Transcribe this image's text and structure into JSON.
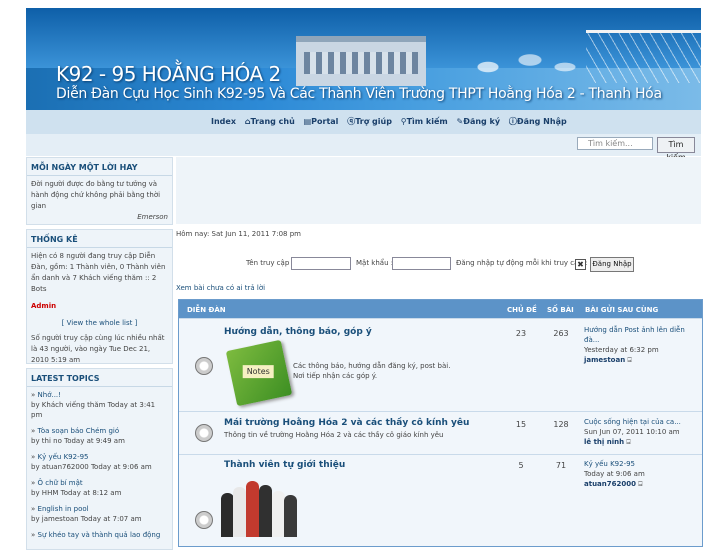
{
  "banner": {
    "title": "K92 - 95 HOẰNG HÓA 2",
    "subtitle": "Diễn Đàn Cựu Học Sinh K92-95 Và Các Thành Viên Trường THPT Hoằng Hóa 2 - Thanh Hóa"
  },
  "nav": {
    "items": [
      {
        "label": "Index",
        "icon": ""
      },
      {
        "label": "Trang chủ",
        "icon": "home-icon"
      },
      {
        "label": "Portal",
        "icon": "portal-icon"
      },
      {
        "label": "Trợ giúp",
        "icon": "help-icon"
      },
      {
        "label": "Tìm kiếm",
        "icon": "search-icon"
      },
      {
        "label": "Đăng ký",
        "icon": "register-icon"
      },
      {
        "label": "Đăng Nhập",
        "icon": "login-icon"
      }
    ]
  },
  "search": {
    "placeholder": "Tìm kiếm...",
    "button": "Tìm kiếm"
  },
  "quote": {
    "header": "MỖI NGÀY MỘT LỜI HAY",
    "text": "Đời người được đo bằng tư tưởng và hành động chứ không phải bằng thời gian",
    "author": "Emerson"
  },
  "stats": {
    "header": "THỐNG KÊ",
    "online": "Hiện có 8 người đang truy cập Diễn Đàn, gồm: 1 Thành viên, 0 Thành viên ẩn danh và 7 Khách viếng thăm :: 2 Bots",
    "admin": "Admin",
    "view_list": "[ View the whole list ]",
    "record": "Số người truy cập cùng lúc nhiều nhất là 43 người, vào ngày Tue Dec 21, 2010 5:19 am"
  },
  "latest": {
    "header": "LATEST TOPICS",
    "items": [
      {
        "title": "Nhớ...!",
        "meta": "by Khách viếng thăm Today at 3:41 pm"
      },
      {
        "title": "Tòa soạn báo Chém gió",
        "meta": "by thi no Today at 9:49 am"
      },
      {
        "title": "Kỷ yếu K92-95",
        "meta": "by atuan762000 Today at 9:06 am"
      },
      {
        "title": "Ô chữ bí mật",
        "meta": "by HHM Today at 8:12 am"
      },
      {
        "title": "English in pool",
        "meta": "by jamestoan Today at 7:07 am"
      },
      {
        "title": "Sự khéo tay và thành quả lao động",
        "meta": ""
      }
    ]
  },
  "main": {
    "now": "Hôm nay: Sat Jun 11, 2011 7:08 pm",
    "username_label": "Tên truy cập :",
    "password_label": "Mật khẩu :",
    "auto_label": "Đăng nhập tự động mỗi khi truy cập :",
    "login_button": "Đăng Nhập",
    "unanswered": "Xem bài chưa có ai trả lời"
  },
  "forum": {
    "headers": {
      "forum": "DIỄN ĐÀN",
      "topics": "CHỦ ĐỀ",
      "posts": "SỐ BÀI",
      "last": "BÀI GỬI SAU CÙNG"
    },
    "rows": [
      {
        "name": "Hướng dẫn, thông báo, góp ý",
        "desc": "Các thông báo, hướng dẫn đăng ký, post bài. Nơi tiếp nhận các góp ý.",
        "topics": "23",
        "posts": "263",
        "last_title": "Hướng dẫn Post ảnh lên diễn đà...",
        "last_time": "Yesterday at 6:32 pm",
        "last_user": "jamestoan",
        "image_text": "Notes"
      },
      {
        "name": "Mái trường Hoằng Hóa 2 và các thầy cô kính yêu",
        "desc": "Thông tin về trường Hoằng Hóa 2 và các thầy cô giáo kính yêu",
        "topics": "15",
        "posts": "128",
        "last_title": "Cuộc sống hiện tại của ca...",
        "last_time": "Sun Jun 07, 2011 10:10 am",
        "last_user": "lê thị ninh",
        "image_text": ""
      },
      {
        "name": "Thành viên tự giới thiệu",
        "desc": "",
        "topics": "5",
        "posts": "71",
        "last_title": "Kỷ yếu K92-95",
        "last_time": "Today at 9:06 am",
        "last_user": "atuan762000",
        "image_text": ""
      }
    ]
  },
  "colors": {
    "nav_bg": "#cfe1ef",
    "header_blue": "#5c93c8",
    "link": "#1a4f7a",
    "admin": "#cc0000"
  }
}
